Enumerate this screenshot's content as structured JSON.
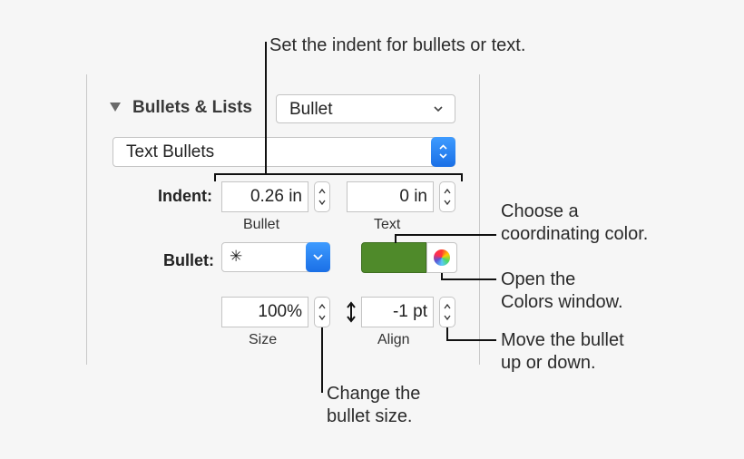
{
  "panel": {
    "title": "Bullets & Lists",
    "list_style_value": "Bullet",
    "bullet_type_value": "Text Bullets"
  },
  "indent": {
    "label": "Indent:",
    "bullet_value": "0.26 in",
    "bullet_sublabel": "Bullet",
    "text_value": "0 in",
    "text_sublabel": "Text"
  },
  "bullet": {
    "label": "Bullet:",
    "symbol": "✳",
    "color": "#4f8a2a"
  },
  "size": {
    "value": "100%",
    "sublabel": "Size"
  },
  "align": {
    "value": "-1 pt",
    "sublabel": "Align"
  },
  "annotations": {
    "indent": "Set the indent for bullets or text.",
    "color_line1": "Choose a",
    "color_line2": "coordinating color.",
    "colors_window_line1": "Open the",
    "colors_window_line2": "Colors window.",
    "move_line1": "Move the bullet",
    "move_line2": "up or down.",
    "size_line1": "Change the",
    "size_line2": "bullet size."
  }
}
